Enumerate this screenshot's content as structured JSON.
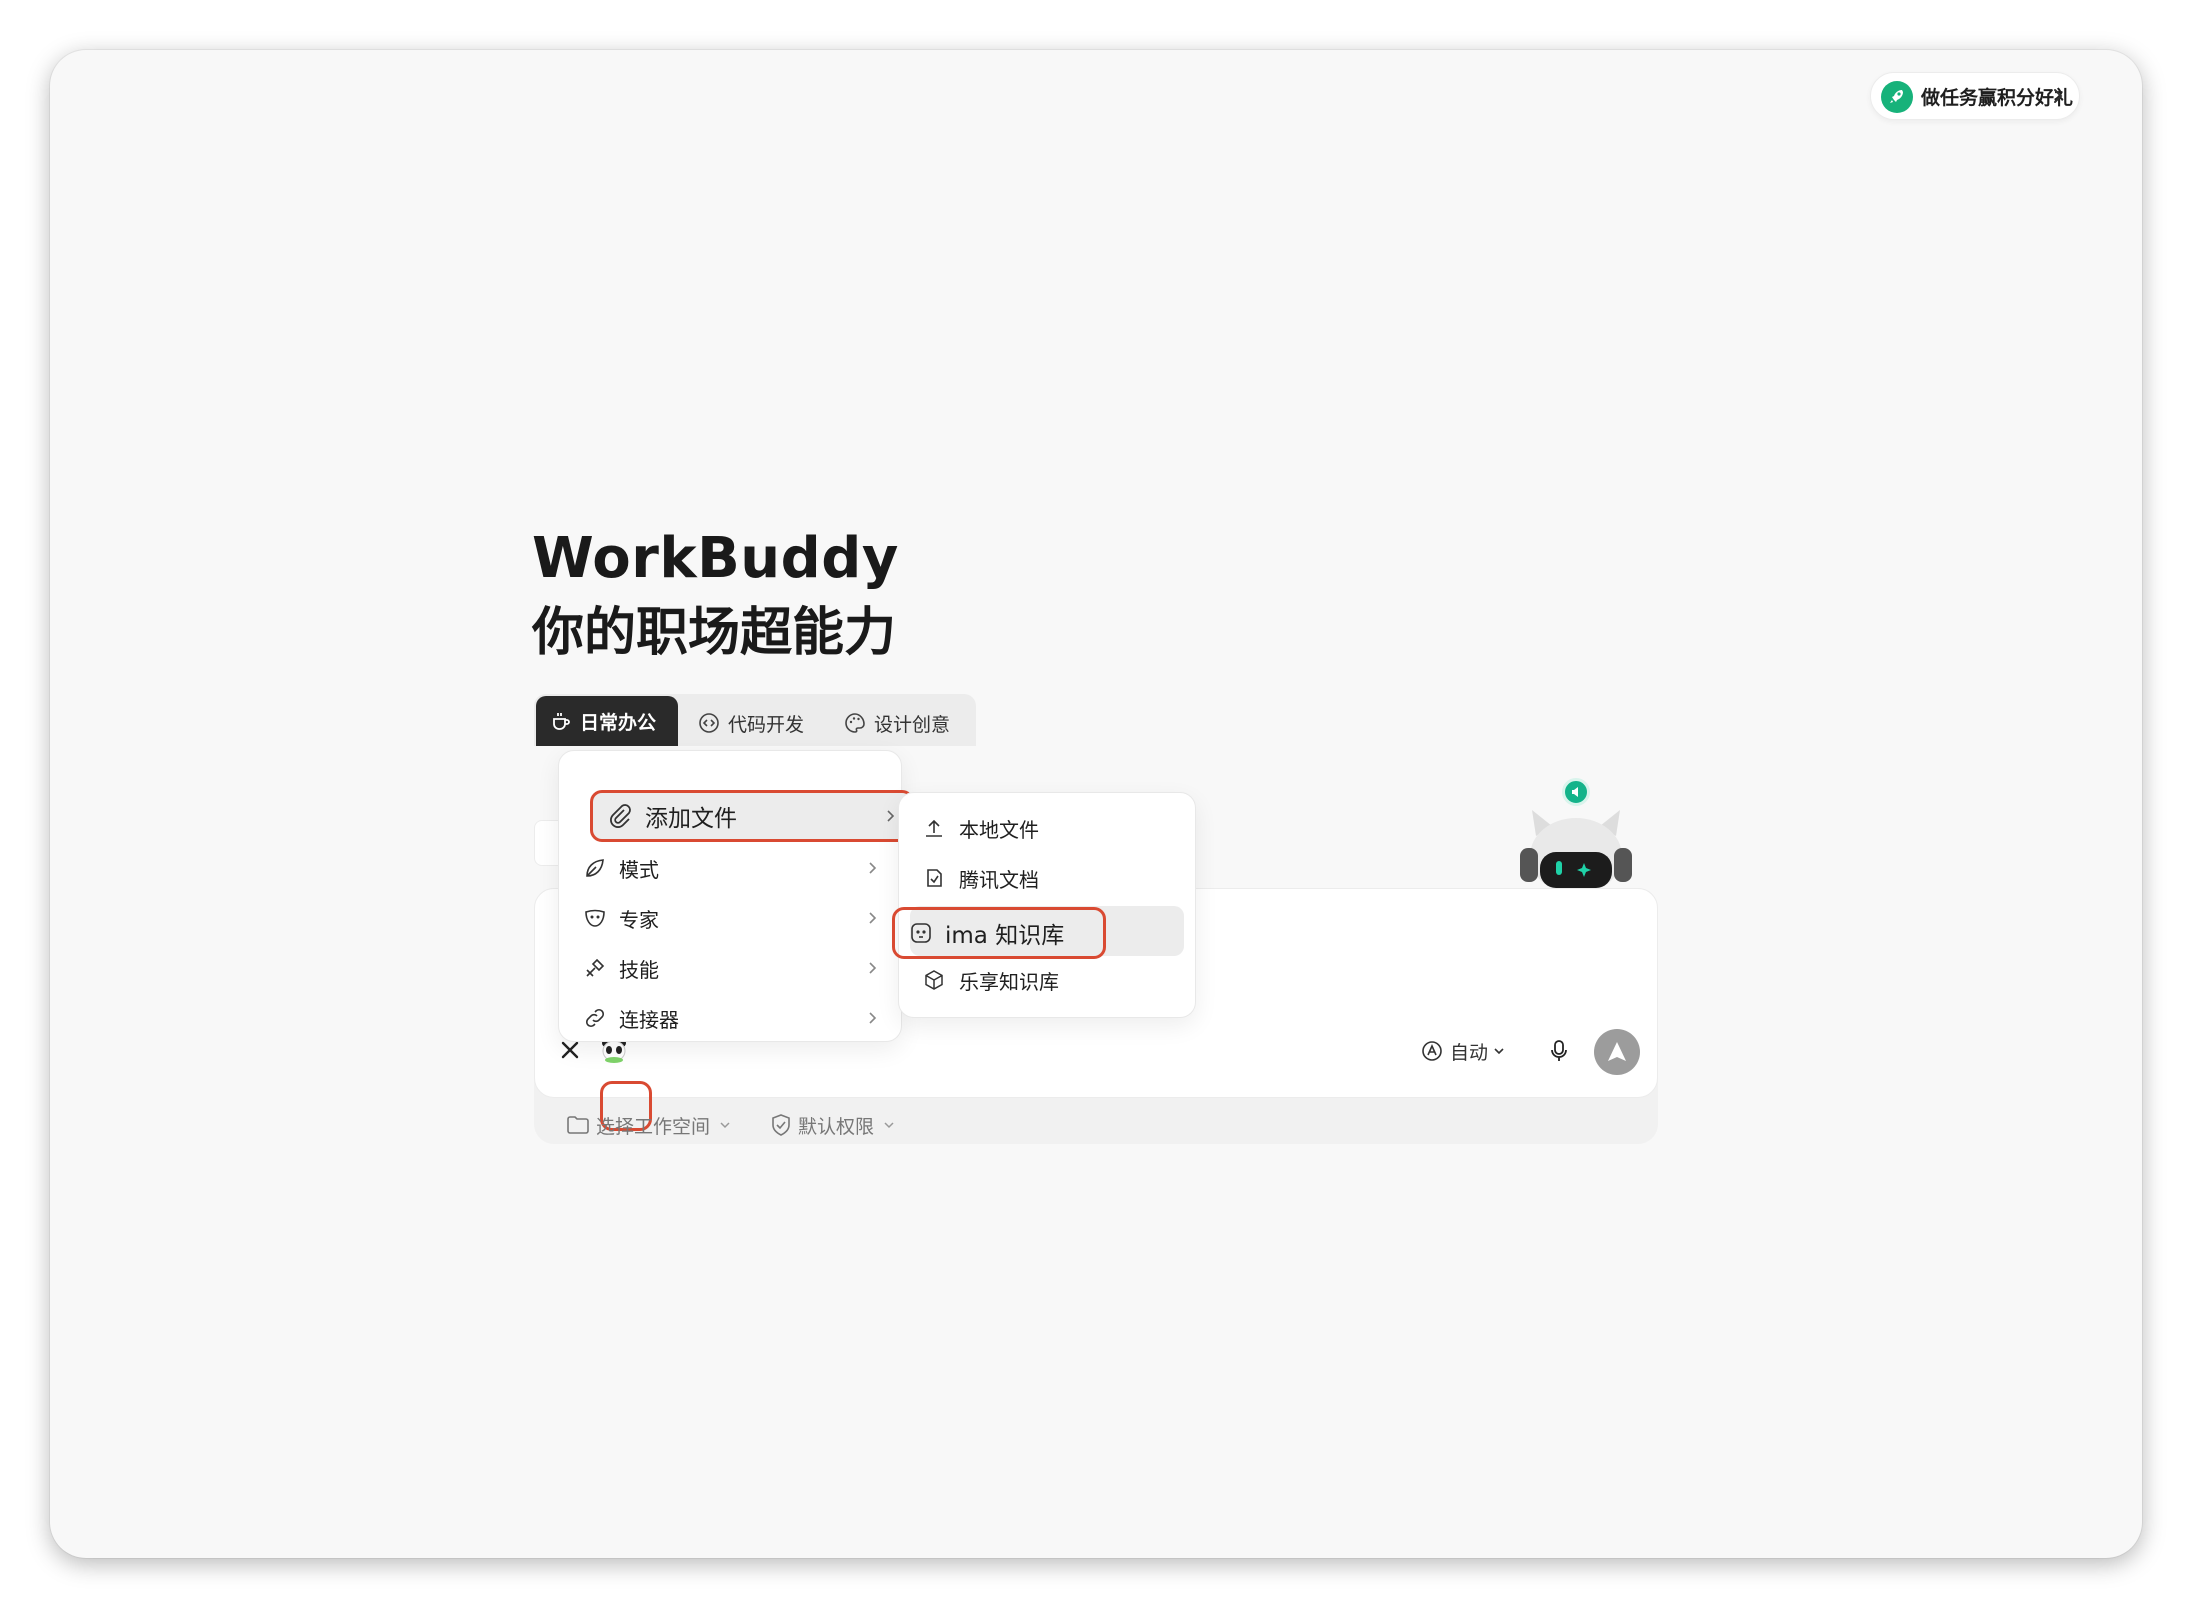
{
  "header": {
    "task_button_label": "做任务赢积分好礼"
  },
  "hero": {
    "title": "WorkBuddy",
    "subtitle": "你的职场超能力"
  },
  "categories": [
    {
      "label": "日常办公",
      "icon": "coffee-icon",
      "active": true
    },
    {
      "label": "代码开发",
      "icon": "code-icon"
    },
    {
      "label": "设计创意",
      "icon": "palette-icon"
    }
  ],
  "menu": {
    "add_file": "添加文件",
    "items": [
      {
        "label": "模式",
        "icon": "leaf-icon"
      },
      {
        "label": "专家",
        "icon": "mask-icon"
      },
      {
        "label": "技能",
        "icon": "tools-icon"
      },
      {
        "label": "连接器",
        "icon": "link-icon"
      }
    ]
  },
  "submenu": {
    "items": [
      {
        "label": "本地文件",
        "icon": "upload-icon"
      },
      {
        "label": "腾讯文档",
        "icon": "doc-icon"
      },
      {
        "label": "ima 知识库",
        "icon": "panda-icon",
        "highlighted": true
      },
      {
        "label": "乐享知识库",
        "icon": "cube-icon"
      }
    ]
  },
  "composer": {
    "mode_label": "自动"
  },
  "footer": {
    "workspace_label": "选择工作空间",
    "permission_label": "默认权限"
  },
  "colors": {
    "accent_red": "#d94a32",
    "brand_green": "#17b27a",
    "send_gray": "#9c9c9c"
  }
}
